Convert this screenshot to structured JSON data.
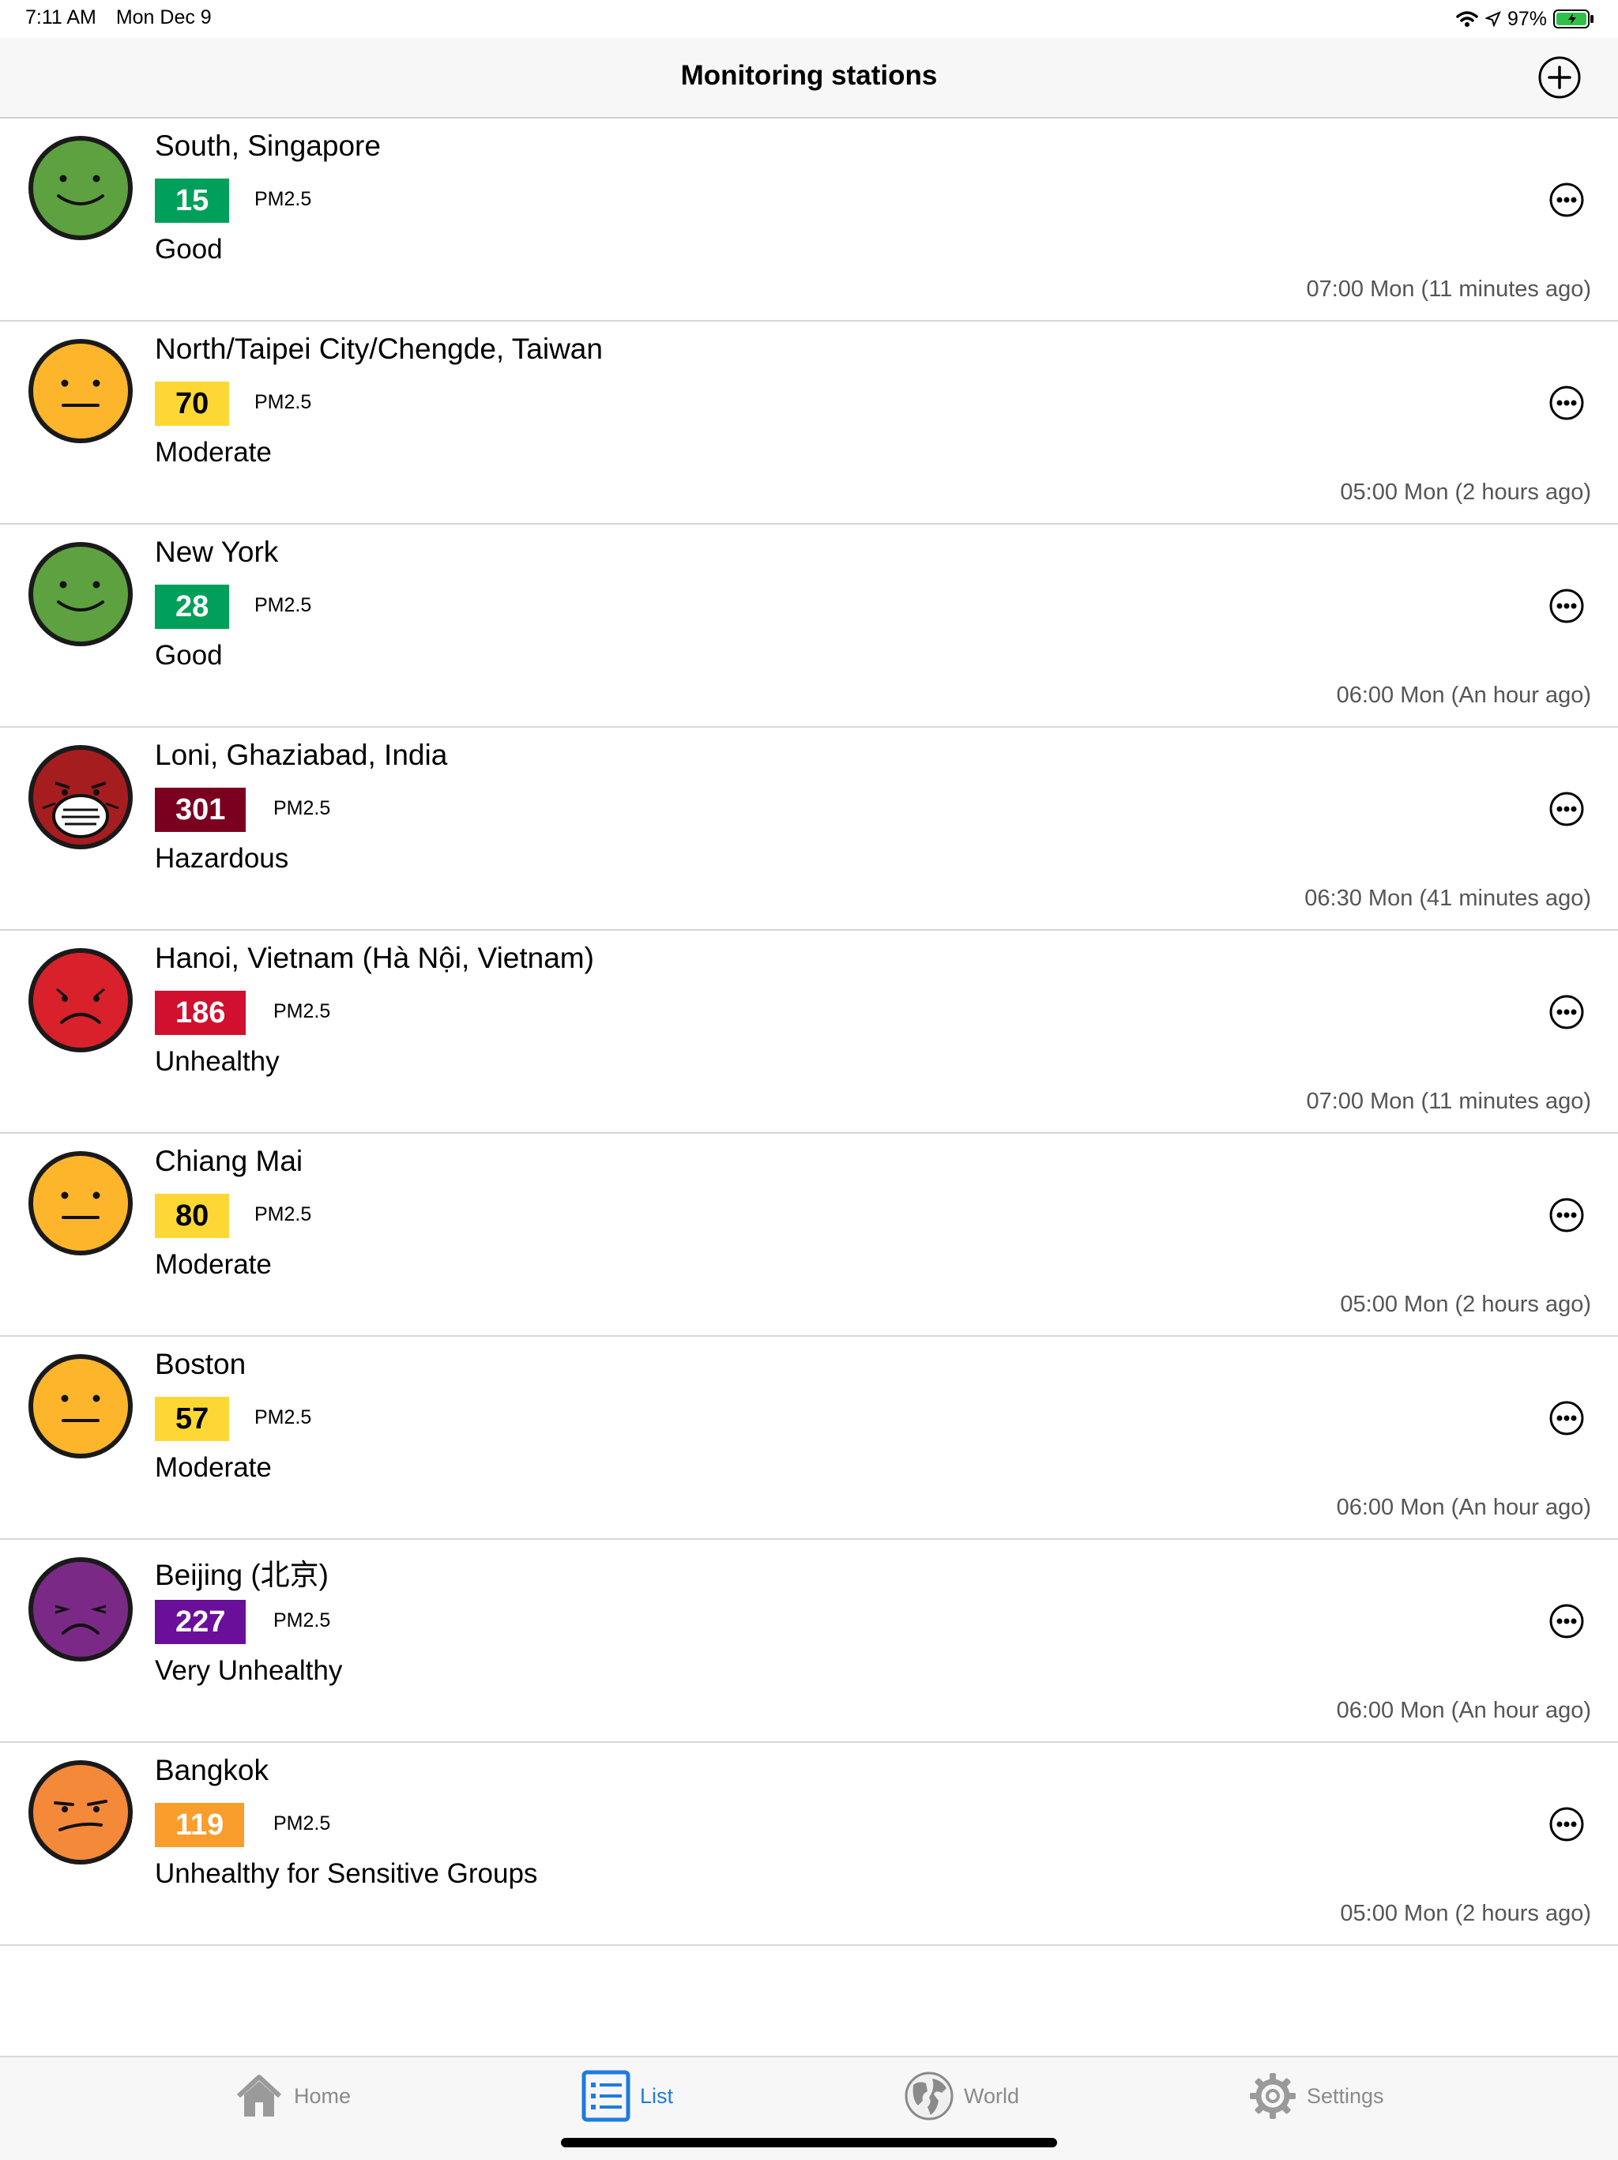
{
  "status_bar": {
    "time": "7:11 AM",
    "date": "Mon Dec 9",
    "battery": "97%"
  },
  "nav": {
    "title": "Monitoring stations",
    "add_icon": "plus-circle-icon"
  },
  "colors": {
    "good": "#00a05a",
    "moderate": "#fdd835",
    "usg": "#f99d2c",
    "unhealthy": "#d0102e",
    "very_unhealthy": "#6a0f9a",
    "hazardous": "#7a0020",
    "accent": "#1e7be0"
  },
  "stations": [
    {
      "name": "South, Singapore",
      "aqi": "15",
      "pollutant": "PM2.5",
      "category": "Good",
      "updated": "07:00 Mon (11 minutes ago)",
      "level": "good",
      "bg": "#00a05a",
      "fg": "#ffffff",
      "face_icon": "smiling-face-icon"
    },
    {
      "name": "North/Taipei City/Chengde, Taiwan",
      "aqi": "70",
      "pollutant": "PM2.5",
      "category": "Moderate",
      "updated": "05:00 Mon (2 hours ago)",
      "level": "moderate",
      "bg": "#fdd835",
      "fg": "#000000",
      "face_icon": "neutral-face-icon"
    },
    {
      "name": "New York",
      "aqi": "28",
      "pollutant": "PM2.5",
      "category": "Good",
      "updated": "06:00 Mon (An hour ago)",
      "level": "good",
      "bg": "#00a05a",
      "fg": "#ffffff",
      "face_icon": "smiling-face-icon"
    },
    {
      "name": "Loni, Ghaziabad, India",
      "aqi": "301",
      "pollutant": "PM2.5",
      "category": "Hazardous",
      "updated": "06:30 Mon (41 minutes ago)",
      "level": "hazardous",
      "bg": "#7a0020",
      "fg": "#ffffff",
      "face_icon": "mask-face-icon"
    },
    {
      "name": "Hanoi, Vietnam (Hà Nội, Vietnam)",
      "aqi": "186",
      "pollutant": "PM2.5",
      "category": "Unhealthy",
      "updated": "07:00 Mon (11 minutes ago)",
      "level": "unhealthy",
      "bg": "#d0102e",
      "fg": "#ffffff",
      "face_icon": "sad-face-icon"
    },
    {
      "name": "Chiang Mai",
      "aqi": "80",
      "pollutant": "PM2.5",
      "category": "Moderate",
      "updated": "05:00 Mon (2 hours ago)",
      "level": "moderate",
      "bg": "#fdd835",
      "fg": "#000000",
      "face_icon": "neutral-face-icon"
    },
    {
      "name": "Boston",
      "aqi": "57",
      "pollutant": "PM2.5",
      "category": "Moderate",
      "updated": "06:00 Mon (An hour ago)",
      "level": "moderate",
      "bg": "#fdd835",
      "fg": "#000000",
      "face_icon": "neutral-face-icon"
    },
    {
      "name": "Beijing (北京)",
      "aqi": "227",
      "pollutant": "PM2.5",
      "category": "Very Unhealthy",
      "updated": "06:00 Mon (An hour ago)",
      "level": "very_unhealthy",
      "bg": "#6a0f9a",
      "fg": "#ffffff",
      "face_icon": "frowning-face-icon"
    },
    {
      "name": "Bangkok",
      "aqi": "119",
      "pollutant": "PM2.5",
      "category": "Unhealthy for Sensitive Groups",
      "updated": "05:00 Mon (2 hours ago)",
      "level": "usg",
      "bg": "#f99d2c",
      "fg": "#ffffff",
      "face_icon": "annoyed-face-icon"
    }
  ],
  "tabs": [
    {
      "label": "Home",
      "icon": "home-icon",
      "active": false
    },
    {
      "label": "List",
      "icon": "list-icon",
      "active": true
    },
    {
      "label": "World",
      "icon": "globe-icon",
      "active": false
    },
    {
      "label": "Settings",
      "icon": "gear-icon",
      "active": false
    }
  ]
}
